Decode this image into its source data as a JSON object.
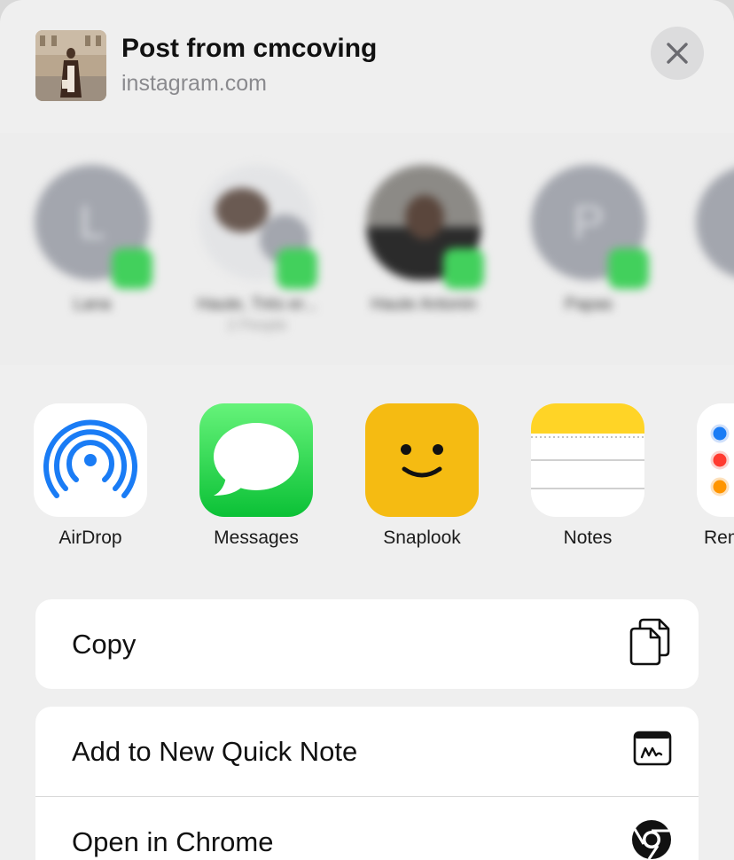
{
  "header": {
    "title": "Post from cmcoving",
    "subtitle": "instagram.com"
  },
  "people": [
    {
      "name": "Lana",
      "sub": "",
      "initial": "L"
    },
    {
      "name": "Haute, Trés er...",
      "sub": "2 People",
      "initial": ""
    },
    {
      "name": "Haute Antonin",
      "sub": "",
      "initial": ""
    },
    {
      "name": "Papas",
      "sub": "",
      "initial": "P"
    }
  ],
  "apps": [
    {
      "label": "AirDrop",
      "icon": "airdrop-icon"
    },
    {
      "label": "Messages",
      "icon": "messages-icon"
    },
    {
      "label": "Snaplook",
      "icon": "snaplook-icon"
    },
    {
      "label": "Notes",
      "icon": "notes-icon"
    },
    {
      "label": "Reminders",
      "icon": "reminders-icon"
    }
  ],
  "actions": {
    "copy": "Copy",
    "quick_note": "Add to New Quick Note",
    "chrome": "Open in Chrome"
  },
  "colors": {
    "messages_green": "#34c759",
    "airdrop_blue": "#1a7cf5",
    "snaplook_yellow": "#f5bb12",
    "notes_yellow": "#ffd426"
  }
}
